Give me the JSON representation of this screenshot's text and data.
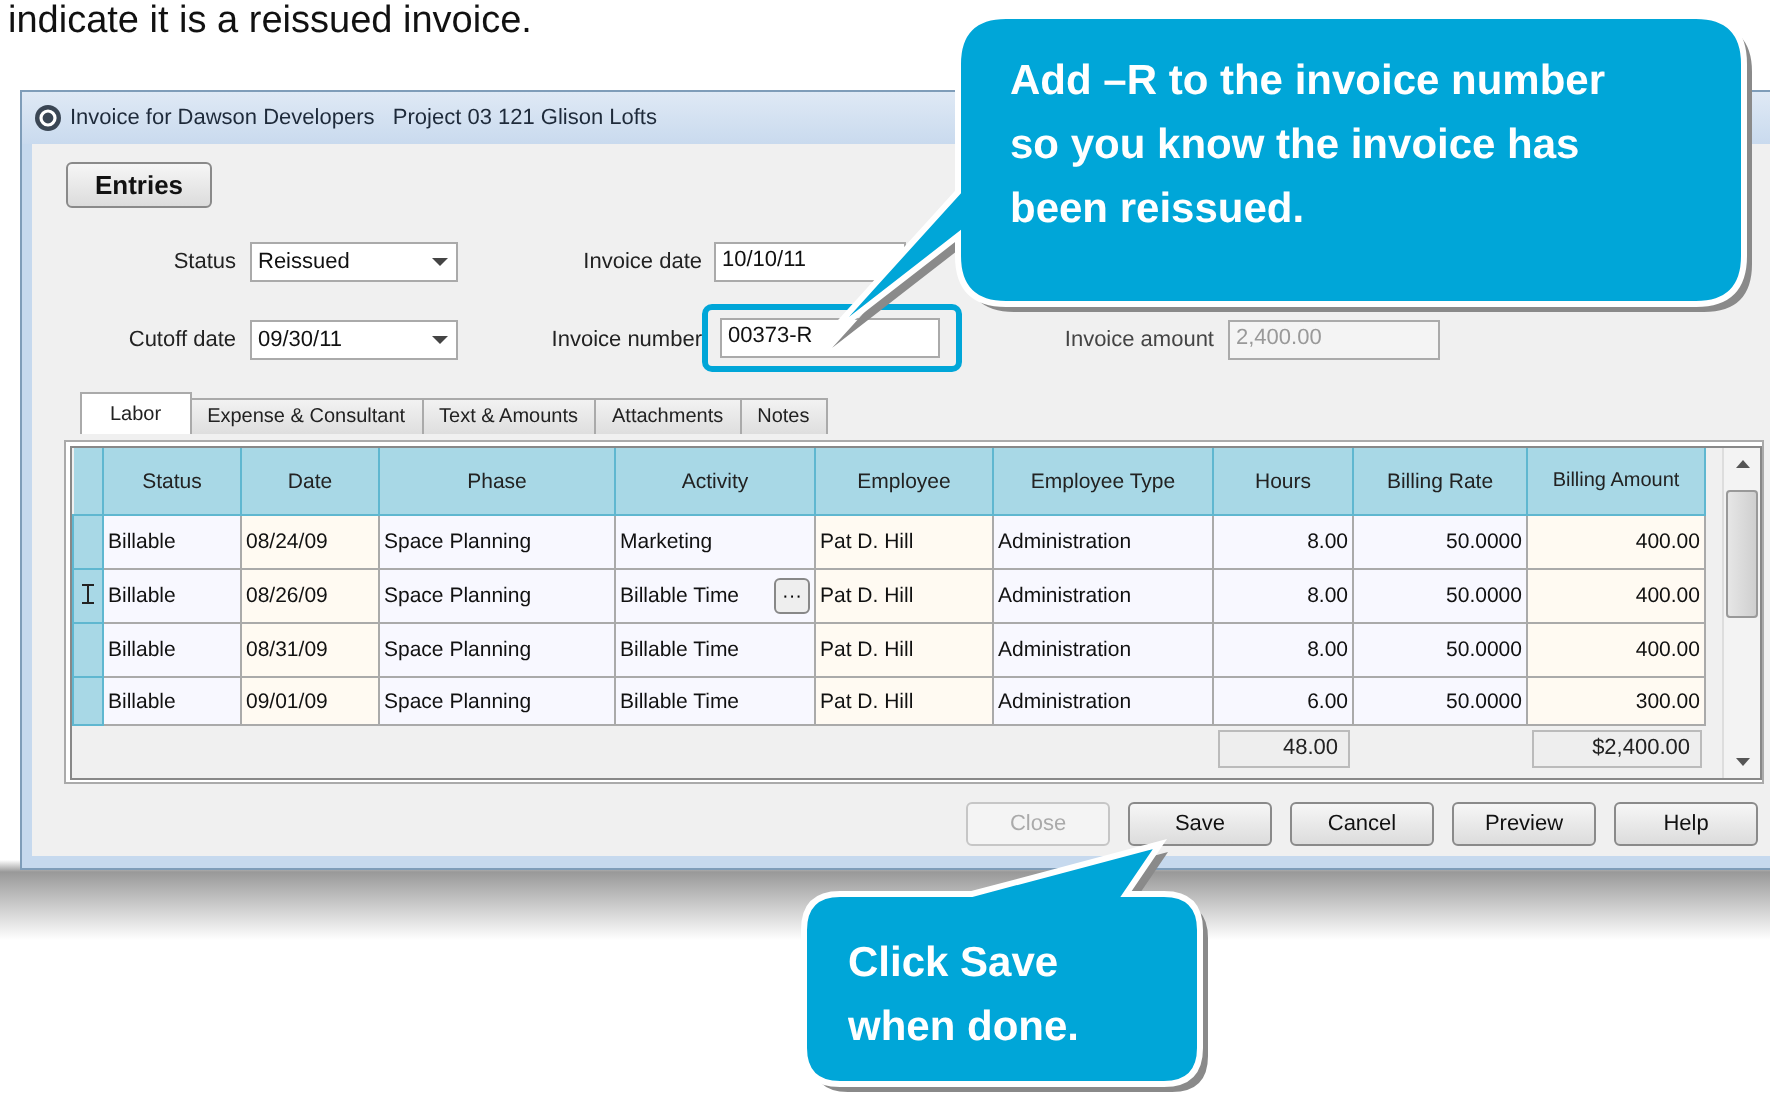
{
  "instruction_text": "indicate it is a reissued invoice.",
  "window": {
    "title": "Invoice for Dawson Developers   Project 03 121 Glison Lofts",
    "entries_button": "Entries",
    "status": {
      "label": "Status",
      "value": "Reissued"
    },
    "invoice_date": {
      "label": "Invoice date",
      "value": "10/10/11"
    },
    "cutoff_date": {
      "label": "Cutoff date",
      "value": "09/30/11"
    },
    "invoice_number": {
      "label": "Invoice number",
      "value": "00373-R",
      "highlighted": true
    },
    "invoice_amount": {
      "label": "Invoice amount",
      "value": "2,400.00",
      "disabled": true
    },
    "tabs": [
      {
        "label": "Labor",
        "selected": true
      },
      {
        "label": "Expense & Consultant",
        "selected": false
      },
      {
        "label": "Text & Amounts",
        "selected": false
      },
      {
        "label": "Attachments",
        "selected": false
      },
      {
        "label": "Notes",
        "selected": false
      }
    ],
    "table": {
      "columns": [
        "Status",
        "Date",
        "Phase",
        "Activity",
        "Employee",
        "Employee Type",
        "Hours",
        "Billing Rate",
        "Billing Amount"
      ],
      "rows": [
        {
          "current": false,
          "cells": [
            "Billable",
            "08/24/09",
            "Space Planning",
            "Marketing",
            "Pat D. Hill",
            "Administration",
            "8.00",
            "50.0000",
            "400.00"
          ]
        },
        {
          "current": true,
          "activity_button": "···",
          "cells": [
            "Billable",
            "08/26/09",
            "Space Planning",
            "Billable Time",
            "Pat D. Hill",
            "Administration",
            "8.00",
            "50.0000",
            "400.00"
          ]
        },
        {
          "current": false,
          "cells": [
            "Billable",
            "08/31/09",
            "Space Planning",
            "Billable Time",
            "Pat D. Hill",
            "Administration",
            "8.00",
            "50.0000",
            "400.00"
          ]
        },
        {
          "current": false,
          "cells": [
            "Billable",
            "09/01/09",
            "Space Planning",
            "Billable Time",
            "Pat D. Hill",
            "Administration",
            "6.00",
            "50.0000",
            "300.00"
          ]
        }
      ],
      "total_hours": "48.00",
      "total_amount": "$2,400.00"
    },
    "buttons": [
      {
        "label": "Close",
        "disabled": true
      },
      {
        "label": "Save",
        "disabled": false
      },
      {
        "label": "Cancel",
        "disabled": false
      },
      {
        "label": "Preview",
        "disabled": false
      },
      {
        "label": "Help",
        "disabled": false
      }
    ]
  },
  "callouts": [
    {
      "text": "Add –R to the invoice number so you know the invoice has been reissued."
    },
    {
      "text": "Click Save when done."
    }
  ]
}
